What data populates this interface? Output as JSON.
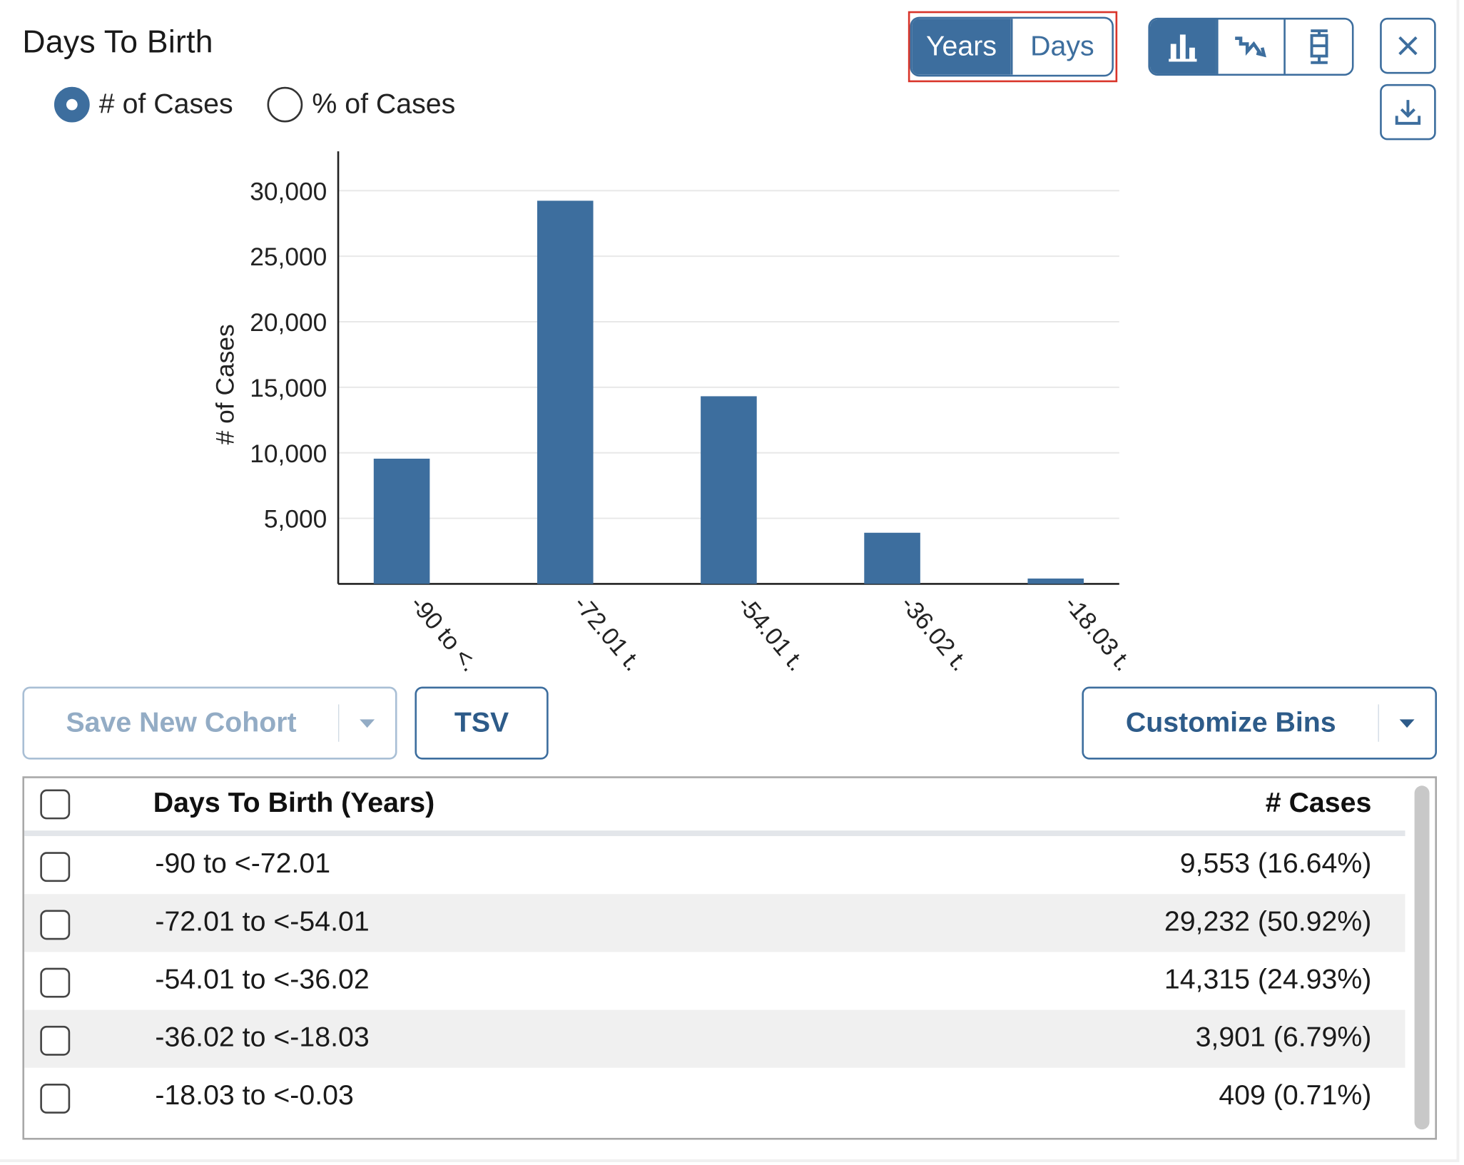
{
  "panel": {
    "title": "Days To Birth",
    "close_icon": "close-icon",
    "download_icon": "download-icon"
  },
  "mode_radio": {
    "selected": "# of Cases",
    "options": [
      "# of Cases",
      "% of Cases"
    ]
  },
  "unit_toggle": {
    "options": [
      "Years",
      "Days"
    ],
    "selected": "Years"
  },
  "chart_type_selector": {
    "options": [
      "bar-chart-icon",
      "survival-plot-icon",
      "box-plot-icon"
    ],
    "selected": "bar-chart-icon"
  },
  "colors": {
    "accent": "#3d6e9e",
    "bar": "#3d6e9e",
    "highlight": "#d9352b",
    "alt_row": "#f0f0f0"
  },
  "chart_data": {
    "type": "bar",
    "categories": [
      "-90 to <.",
      "-72.01 t.",
      "-54.01 t.",
      "-36.02 t.",
      "-18.03 t."
    ],
    "values": [
      9553,
      29232,
      14315,
      3901,
      409
    ],
    "ylabel": "# of Cases",
    "ylim": [
      0,
      33000
    ],
    "yticks": [
      5000,
      10000,
      15000,
      20000,
      25000,
      30000
    ],
    "ytick_labels": [
      "5,000",
      "10,000",
      "15,000",
      "20,000",
      "25,000",
      "30,000"
    ],
    "grid": true
  },
  "actions": {
    "save_cohort_label": "Save New Cohort",
    "tsv_label": "TSV",
    "customize_bins_label": "Customize Bins"
  },
  "table": {
    "header_label": "Days To Birth (Years)",
    "header_count": "# Cases",
    "rows": [
      {
        "label": "-90 to <-72.01",
        "count": "9,553 (16.64%)"
      },
      {
        "label": "-72.01 to <-54.01",
        "count": "29,232 (50.92%)"
      },
      {
        "label": "-54.01 to <-36.02",
        "count": "14,315 (24.93%)"
      },
      {
        "label": "-36.02 to <-18.03",
        "count": "3,901 (6.79%)"
      },
      {
        "label": "-18.03 to <-0.03",
        "count": "409 (0.71%)"
      }
    ]
  }
}
